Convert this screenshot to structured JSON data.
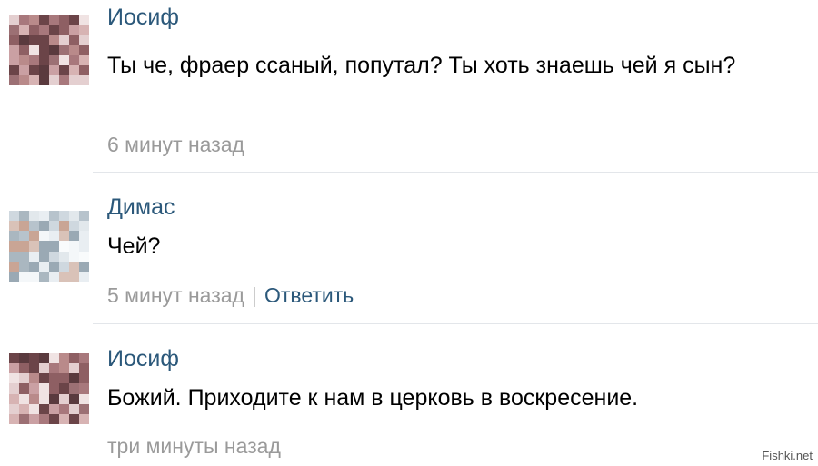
{
  "comments": [
    {
      "author": "Иосиф",
      "text": "Ты че, фраер ссаный, попутал? Ты хоть знаешь чей я сын?",
      "time": "6 минут назад",
      "reply": ""
    },
    {
      "author": "Димас",
      "text": "Чей?",
      "time": "5 минут назад",
      "separator": "|",
      "reply": "Ответить"
    },
    {
      "author": "Иосиф",
      "text": "Божий. Приходите к нам в церковь в воскресение.",
      "time": "три минуты назад",
      "reply": ""
    }
  ],
  "watermark": "Fishki.net",
  "colors": {
    "author": "#2b587a",
    "text": "#000000",
    "meta": "#9a9a9a",
    "divider": "#e3e6ea"
  }
}
